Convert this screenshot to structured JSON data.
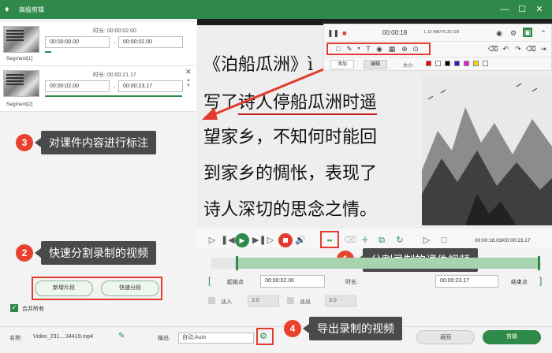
{
  "titlebar": {
    "title": "高级剪辑",
    "logo_icon": "app-logo-icon",
    "controls": [
      "minimize-icon",
      "maximize-icon",
      "close-icon"
    ]
  },
  "segments": [
    {
      "label": "Segment[1]",
      "duration_label": "时长:",
      "duration": "00:00:02.00",
      "start": "00:00:00.00",
      "end": "00:00:02.00"
    },
    {
      "label": "Segment[2]",
      "duration_label": "时长:",
      "duration": "00:00:21.17",
      "start": "00:00:02.00",
      "end": "00:00:23.17"
    }
  ],
  "left_buttons": {
    "new_segment": "新增片段",
    "quick_split": "快速分段"
  },
  "merge_all": "合并所有",
  "callouts": {
    "c1": {
      "num": "1",
      "text": "分割录制的课件视频"
    },
    "c2": {
      "num": "2",
      "text": "快速分割录制的视频"
    },
    "c3": {
      "num": "3",
      "text": "对课件内容进行标注"
    },
    "c4": {
      "num": "4",
      "text": "导出录制的视频"
    }
  },
  "video": {
    "line1": "《泊船瓜洲》ì",
    "line2a": "写了",
    "line2b": "诗人停船瓜洲时遥",
    "line3": "望家乡，不知何时能回",
    "line4": "到家乡的惆怅，表现了",
    "line5": "诗人深切的思念之情。"
  },
  "annotation_toolbar": {
    "rec_time": "00:00:18",
    "storage": "1.19 MB/76.35 GB",
    "tab_add": "添加",
    "tab_edit": "编辑",
    "size_label": "大小:",
    "colors": [
      "#ff0000",
      "#ffffff",
      "#000000",
      "#1e1ec8",
      "#e41bd6",
      "#ffd400",
      "#ffffff"
    ]
  },
  "controls": {
    "time_readout": "00:00:18.03/00:00:23.17"
  },
  "trim": {
    "start_label": "起始点",
    "start": "00:00:02.00",
    "duration_label": "时长:",
    "end": "00:00:23.17",
    "end_label": "结束点"
  },
  "fade": {
    "in_label": "淡入",
    "in_value": "3.0",
    "out_label": "淡出",
    "out_value": "3.0"
  },
  "footer": {
    "name_label": "名称:",
    "name_value": "Video_231....34419.mp4",
    "output_label": "输出:",
    "output_value": "自动;Auto",
    "back": "返回",
    "cut": "剪辑"
  }
}
